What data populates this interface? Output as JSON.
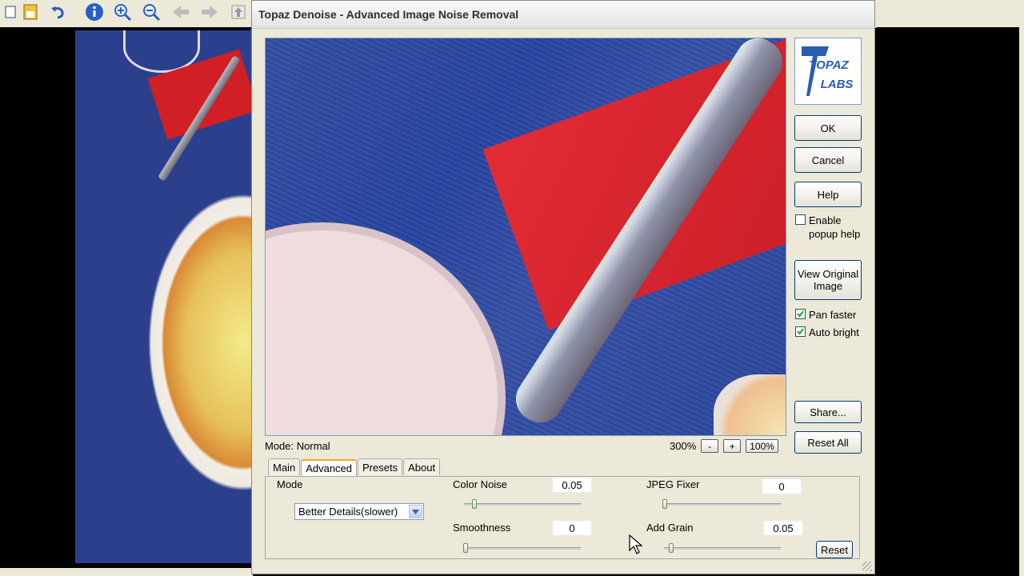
{
  "dialog": {
    "title": "Topaz Denoise - Advanced Image Noise Removal",
    "logo_text": [
      "TOPAZ",
      "LABS"
    ]
  },
  "preview": {
    "mode_label": "Mode: Normal",
    "zoom_level": "300%",
    "zoom_out_label": "-",
    "zoom_in_label": "+",
    "zoom_100_label": "100%"
  },
  "sidebar": {
    "ok": "OK",
    "cancel": "Cancel",
    "help": "Help",
    "enable_popup_help": "Enable popup help",
    "enable_popup_help_checked": false,
    "view_original": "View Original Image",
    "pan_faster": "Pan faster",
    "pan_faster_checked": true,
    "auto_bright": "Auto bright",
    "auto_bright_checked": true,
    "share": "Share...",
    "reset_all": "Reset All"
  },
  "tabs": [
    {
      "label": "Main",
      "active": false
    },
    {
      "label": "Advanced",
      "active": true
    },
    {
      "label": "Presets",
      "active": false
    },
    {
      "label": "About",
      "active": false
    }
  ],
  "advanced": {
    "mode_label": "Mode",
    "mode_value": "Better Details(slower)",
    "color_noise": {
      "label": "Color Noise",
      "value": "0.05",
      "slider": 0.05
    },
    "smoothness": {
      "label": "Smoothness",
      "value": "0",
      "slider": 0
    },
    "jpeg_fixer": {
      "label": "JPEG Fixer",
      "value": "0",
      "slider": 0
    },
    "add_grain": {
      "label": "Add Grain",
      "value": "0.05",
      "slider": 0.05
    },
    "reset": "Reset"
  },
  "colors": {
    "dialog_bg": "#ece9d8",
    "button_border": "#003c74",
    "active_tab_accent": "#f5a623",
    "logo_blue": "#2a5db0"
  },
  "icons": [
    "copy-icon",
    "save-icon",
    "undo-icon",
    "info-icon",
    "zoom-in-icon",
    "zoom-out-icon",
    "back-arrow-icon",
    "forward-arrow-icon",
    "up-icon",
    "chevron-down-icon",
    "checkmark-icon",
    "mouse-cursor-icon",
    "resize-grip-icon"
  ]
}
